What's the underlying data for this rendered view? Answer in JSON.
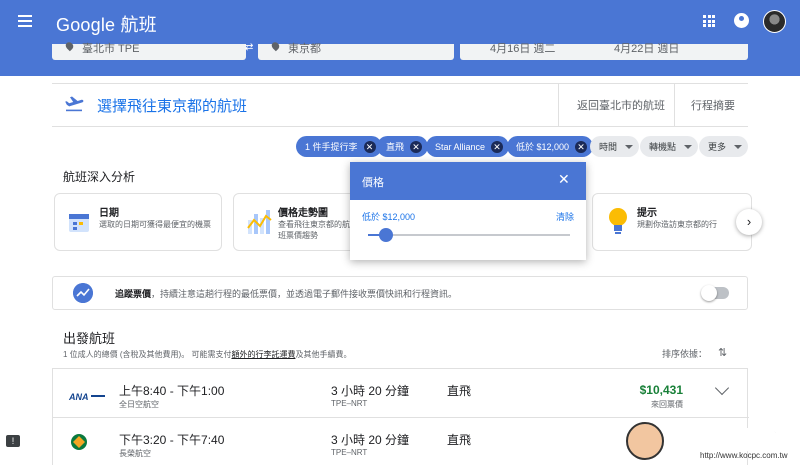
{
  "app": {
    "title": "Google 航班"
  },
  "search": {
    "origin": "臺北市 TPE",
    "destination": "東京都",
    "depart_date": "4月16日 週二",
    "return_date": "4月22日 週日"
  },
  "header": {
    "title": "選擇飛往東京都的航班",
    "back_link": "返回臺北市的航班",
    "summary_link": "行程摘要"
  },
  "filters": [
    {
      "label": "1 件手提行李",
      "active": true
    },
    {
      "label": "直飛",
      "active": true
    },
    {
      "label": "Star Alliance",
      "active": true
    },
    {
      "label": "低於 $12,000",
      "active": true
    },
    {
      "label": "時間",
      "active": false
    },
    {
      "label": "轉機點",
      "active": false
    },
    {
      "label": "更多",
      "active": false
    }
  ],
  "insights": {
    "title": "航班深入分析",
    "cards": [
      {
        "title": "日期",
        "desc": "選取的日期可獲得最便宜的機票",
        "icon": "calendar-icon"
      },
      {
        "title": "價格走勢圖",
        "desc": "查看飛往東京都的航班票價趨勢",
        "icon": "bar-chart-icon"
      },
      {
        "title": "提示",
        "desc": "規劃你造訪東京都的行",
        "icon": "lightbulb-icon"
      }
    ],
    "next_label": "›"
  },
  "price_popup": {
    "title": "價格",
    "close_label": "✕",
    "value_label": "低於 $12,000",
    "clear_label": "清除",
    "slider_fraction": 0.09
  },
  "track": {
    "bold": "追蹤票價",
    "text": "，持續注意這趟行程的最低票價，並透過電子郵件接收票價快訊和行程資訊。",
    "enabled": false
  },
  "departing": {
    "title": "出發航班",
    "note_prefix": "1 位成人的總價 (含稅及其他費用)。 可能需支付",
    "note_link": "額外的行李託運費",
    "note_suffix": "及其他手續費。",
    "sort_label": "排序依據：",
    "flights": [
      {
        "airline_logo": "ANA",
        "time": "上午8:40 - 下午1:00",
        "airline": "全日空航空",
        "duration": "3 小時 20 分鐘",
        "route": "TPE–NRT",
        "stops": "直飛",
        "price": "$10,431",
        "price_note": "來回票價"
      },
      {
        "airline_logo": "EVA",
        "time": "下午3:20 - 下午7:40",
        "airline": "長榮航空",
        "duration": "3 小時 20 分鐘",
        "route": "TPE–NRT",
        "stops": "直飛",
        "price": "",
        "price_note": ""
      }
    ]
  },
  "watermark": {
    "text": "電腦王阿達",
    "url": "http://www.kocpc.com.tw"
  },
  "colors": {
    "primary": "#4a76d4",
    "chip_x": "#1b2a58",
    "price_green": "#188038",
    "link_blue": "#1a73e8"
  }
}
